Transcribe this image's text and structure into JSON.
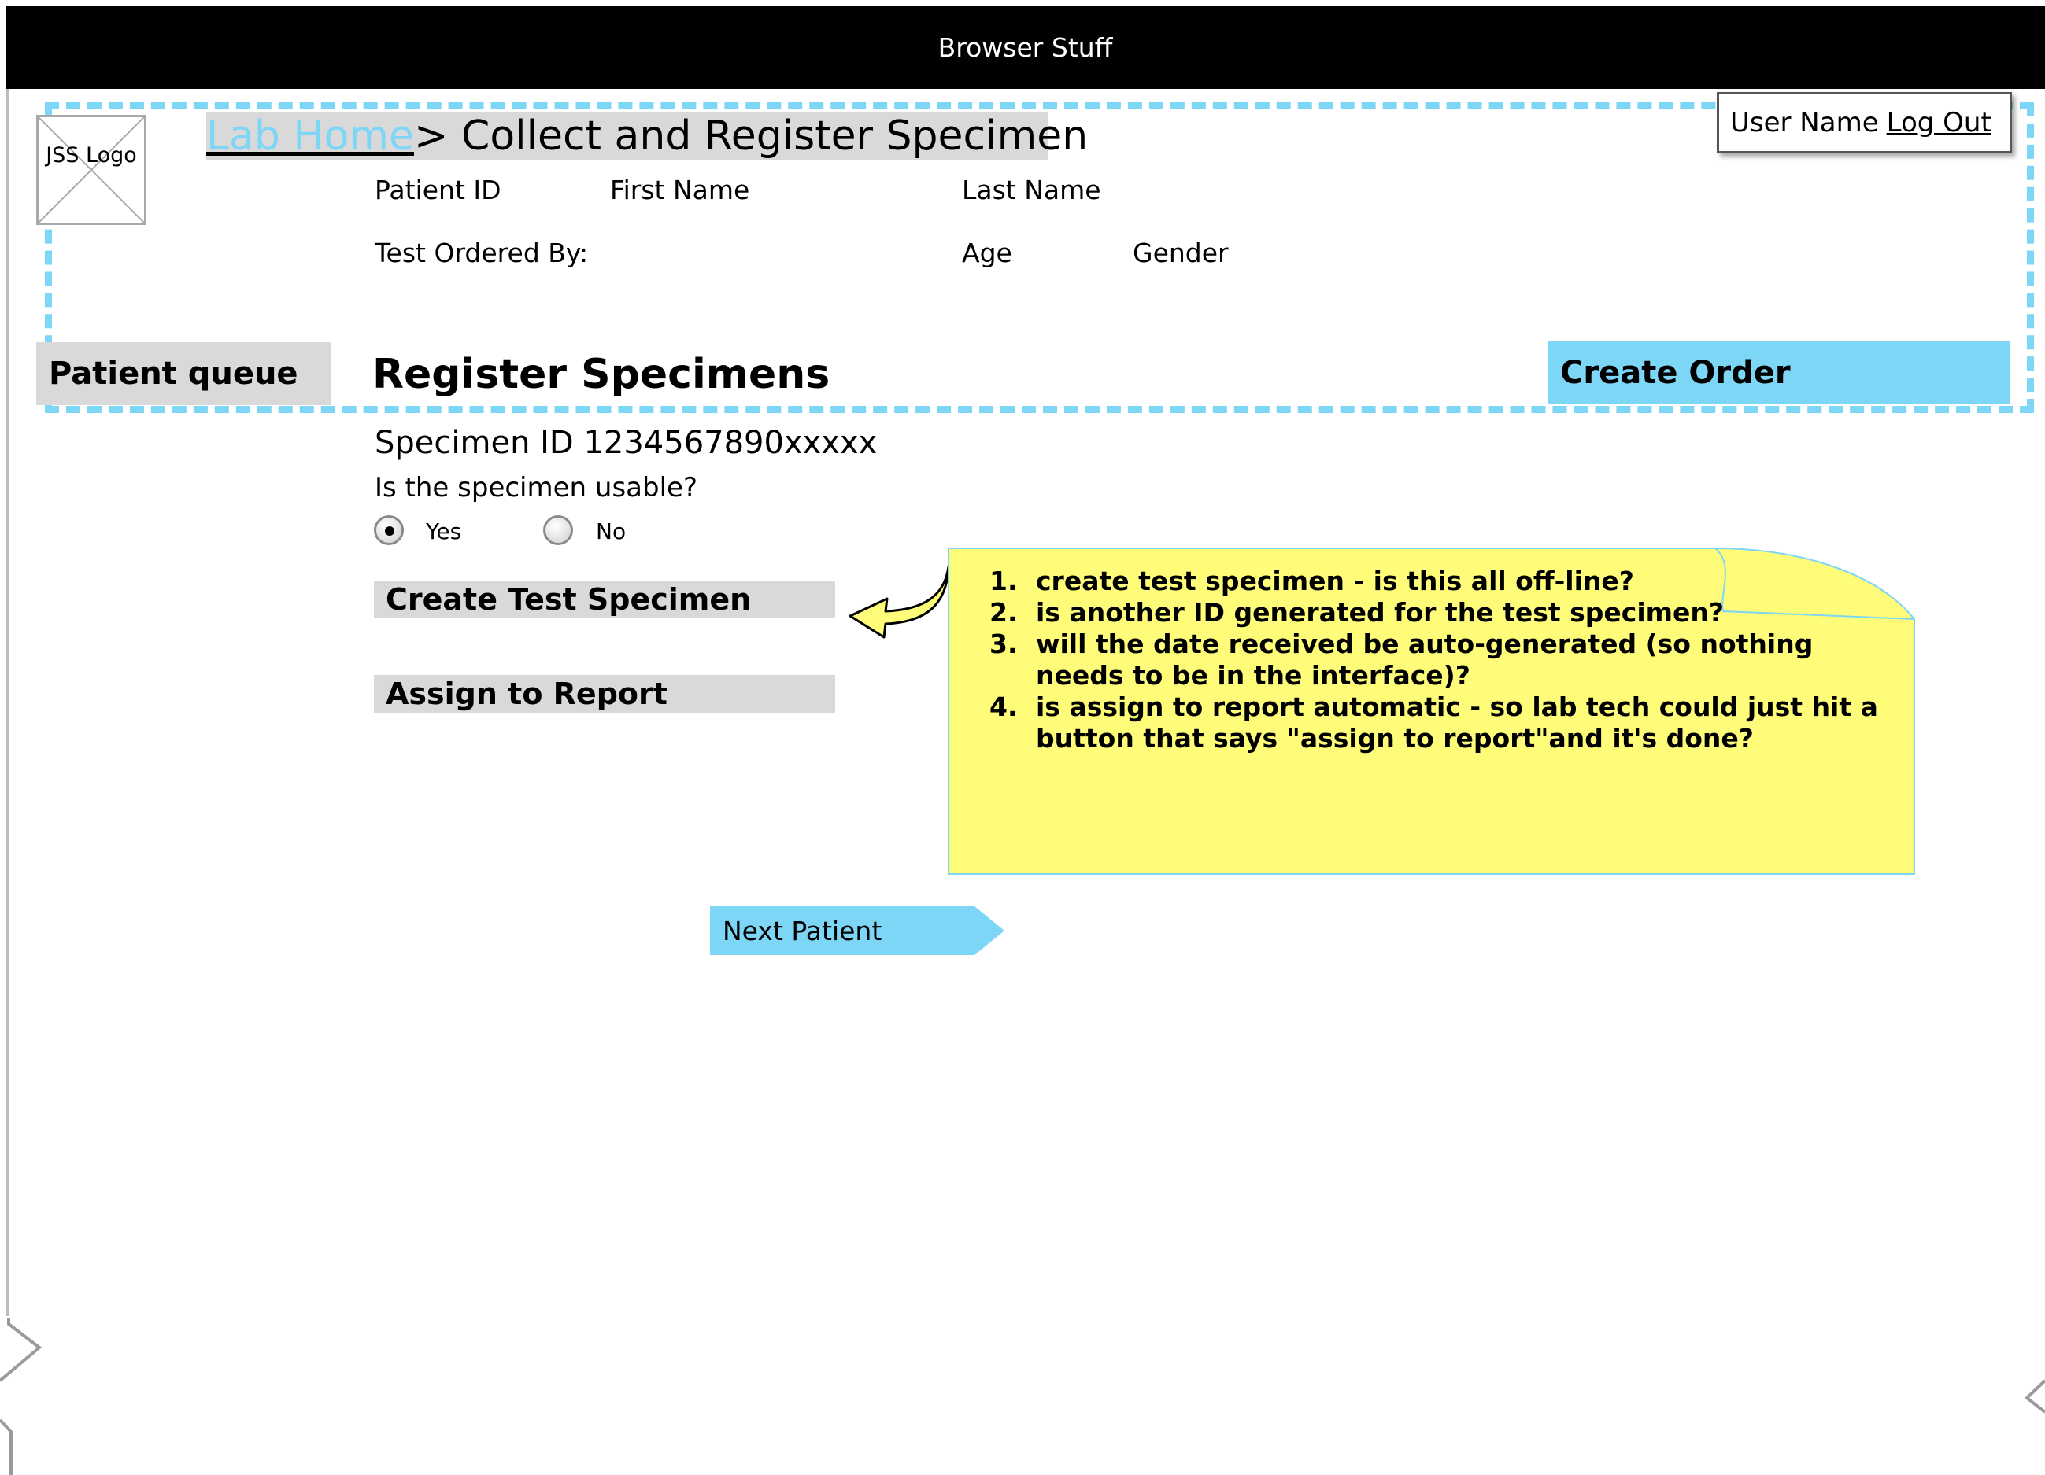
{
  "browser": {
    "title": "Browser Stuff"
  },
  "logo": {
    "text": "JSS Logo"
  },
  "breadcrumb": {
    "home_link": "Lab Home ",
    "current": "> Collect and Register Specimen"
  },
  "user": {
    "name": "User Name",
    "logout": "Log Out"
  },
  "patient_info": {
    "patient_id": "Patient ID",
    "first_name": "First Name",
    "last_name": "Last Name",
    "ordered_by": "Test Ordered By:",
    "age": "Age",
    "gender": "Gender"
  },
  "nav": {
    "patient_queue": "Patient queue",
    "create_order": "Create Order"
  },
  "main": {
    "title": "Register Specimens",
    "specimen_id": "Specimen ID 1234567890xxxxx",
    "usable_question": "Is the specimen usable?",
    "radio_options": [
      {
        "label": "Yes",
        "selected": true
      },
      {
        "label": "No",
        "selected": false
      }
    ],
    "create_test_specimen": "Create Test Specimen",
    "assign_to_report": "Assign to Report",
    "next_patient": "Next Patient"
  },
  "note": {
    "items": [
      "create test specimen - is this all off-line?",
      "is another ID generated for the test specimen?",
      "will the date received be auto-generated (so nothing needs to be in the interface)?",
      "is assign to report automatic - so lab tech could just hit a button that says \"assign to report\"and it's done?"
    ]
  },
  "colors": {
    "accent": "#7dd6f6",
    "gray_fill": "#d9d9d9",
    "note_fill": "#fffc79",
    "browser_bar": "#000000"
  }
}
